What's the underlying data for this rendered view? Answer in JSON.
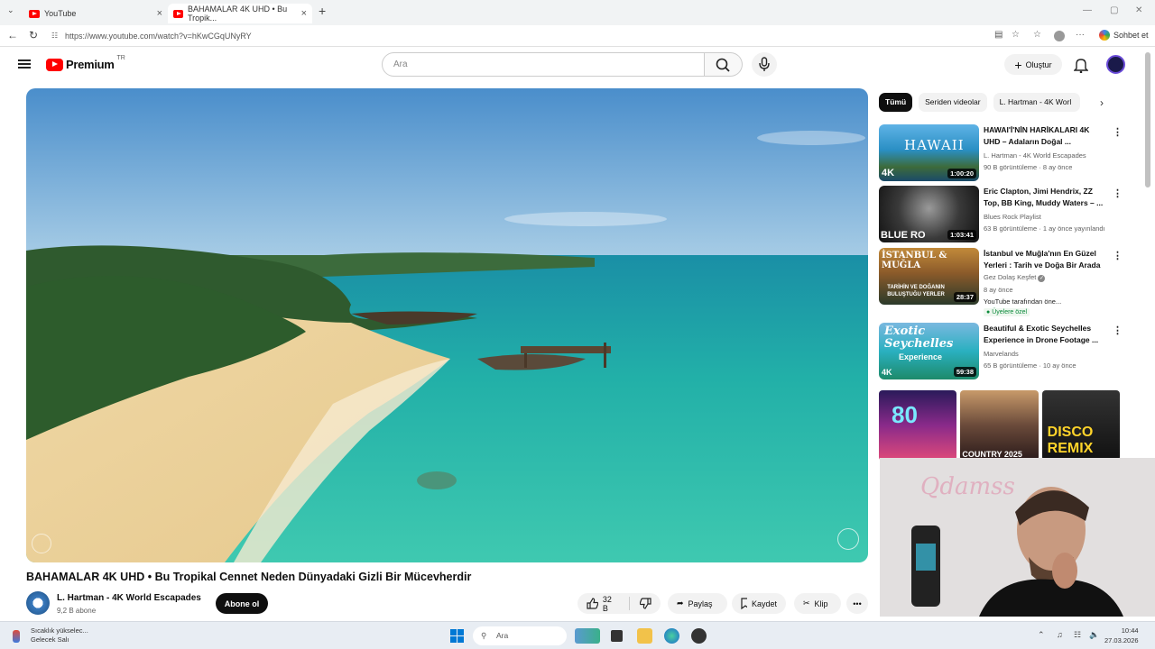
{
  "browser": {
    "tabs": [
      {
        "label": "YouTube"
      },
      {
        "label": "BAHAMALAR 4K UHD • Bu Tropik..."
      }
    ],
    "new_tab": "+",
    "url": "https://www.youtube.com/watch?v=hKwCGqUNyRY",
    "sohbet_label": "Sohbet et"
  },
  "header": {
    "logo_text": "Premium",
    "logo_region": "TR",
    "search_placeholder": "Ara",
    "create_label": "Oluştur"
  },
  "video": {
    "title": "BAHAMALAR 4K UHD • Bu Tropikal Cennet Neden Dünyadaki Gizli Bir Mücevherdir",
    "channel": "L. Hartman - 4K World Escapades",
    "subscribers": "9,2 B abone",
    "subscribe_label": "Abone ol",
    "likes": "32 B",
    "share_label": "Paylaş",
    "save_label": "Kaydet",
    "clip_label": "Klip"
  },
  "sidebar": {
    "chips": [
      "Tümü",
      "Seriden videolar",
      "L. Hartman - 4K Worl"
    ],
    "recommendations": [
      {
        "title": "HAWAI'İ'NİN HARİKALARI 4K UHD – Adaların Doğal ...",
        "channel": "L. Hartman - 4K World Escapades",
        "meta": "90 B görüntüleme · 8 ay önce",
        "duration": "1:00:20",
        "thumb_text": "HAWAII",
        "badge": "4K"
      },
      {
        "title": "Eric Clapton, Jimi Hendrix, ZZ Top, BB King, Muddy Waters – ...",
        "channel": "Blues Rock Playlist",
        "meta": "63 B görüntüleme · 1 ay önce yayınlandı",
        "duration": "1:03:41",
        "thumb_text": "BLUE RO"
      },
      {
        "title": "İstanbul ve Muğla'nın En Güzel Yerleri : Tarih ve Doğa Bir Arada",
        "channel": "Gez Dolaş Keşfet",
        "meta": "8 ay önce",
        "extra": "YouTube tarafından öne...",
        "members": "Üyelere özel",
        "duration": "28:37",
        "thumb_text": "İSTANBUL & MUĞLA",
        "thumb_sub": "TARİHİN VE DOĞANIN BULUŞTUĞU YERLER"
      },
      {
        "title": "Beautiful & Exotic Seychelles Experience in Drone Footage ...",
        "channel": "Marvelands",
        "meta": "65 B görüntüleme · 10 ay önce",
        "duration": "59:38",
        "thumb_text": "Exotic Seychelles",
        "thumb_sub": "Experience",
        "badge": "4K"
      }
    ],
    "mix_labels": [
      "80",
      "COUNTRY 2025",
      "DISCO REMIX"
    ]
  },
  "taskbar": {
    "weather_line1": "Sıcaklık yükselec...",
    "weather_line2": "Gelecek Salı",
    "search_placeholder": "Ara",
    "time": "10:44",
    "date": "27.03.2026"
  },
  "colors": {
    "youtube_red": "#ff0000",
    "text_primary": "#0f0f0f",
    "text_secondary": "#606060",
    "chip_bg": "#f2f2f2",
    "members_green": "#0a8a3a"
  }
}
